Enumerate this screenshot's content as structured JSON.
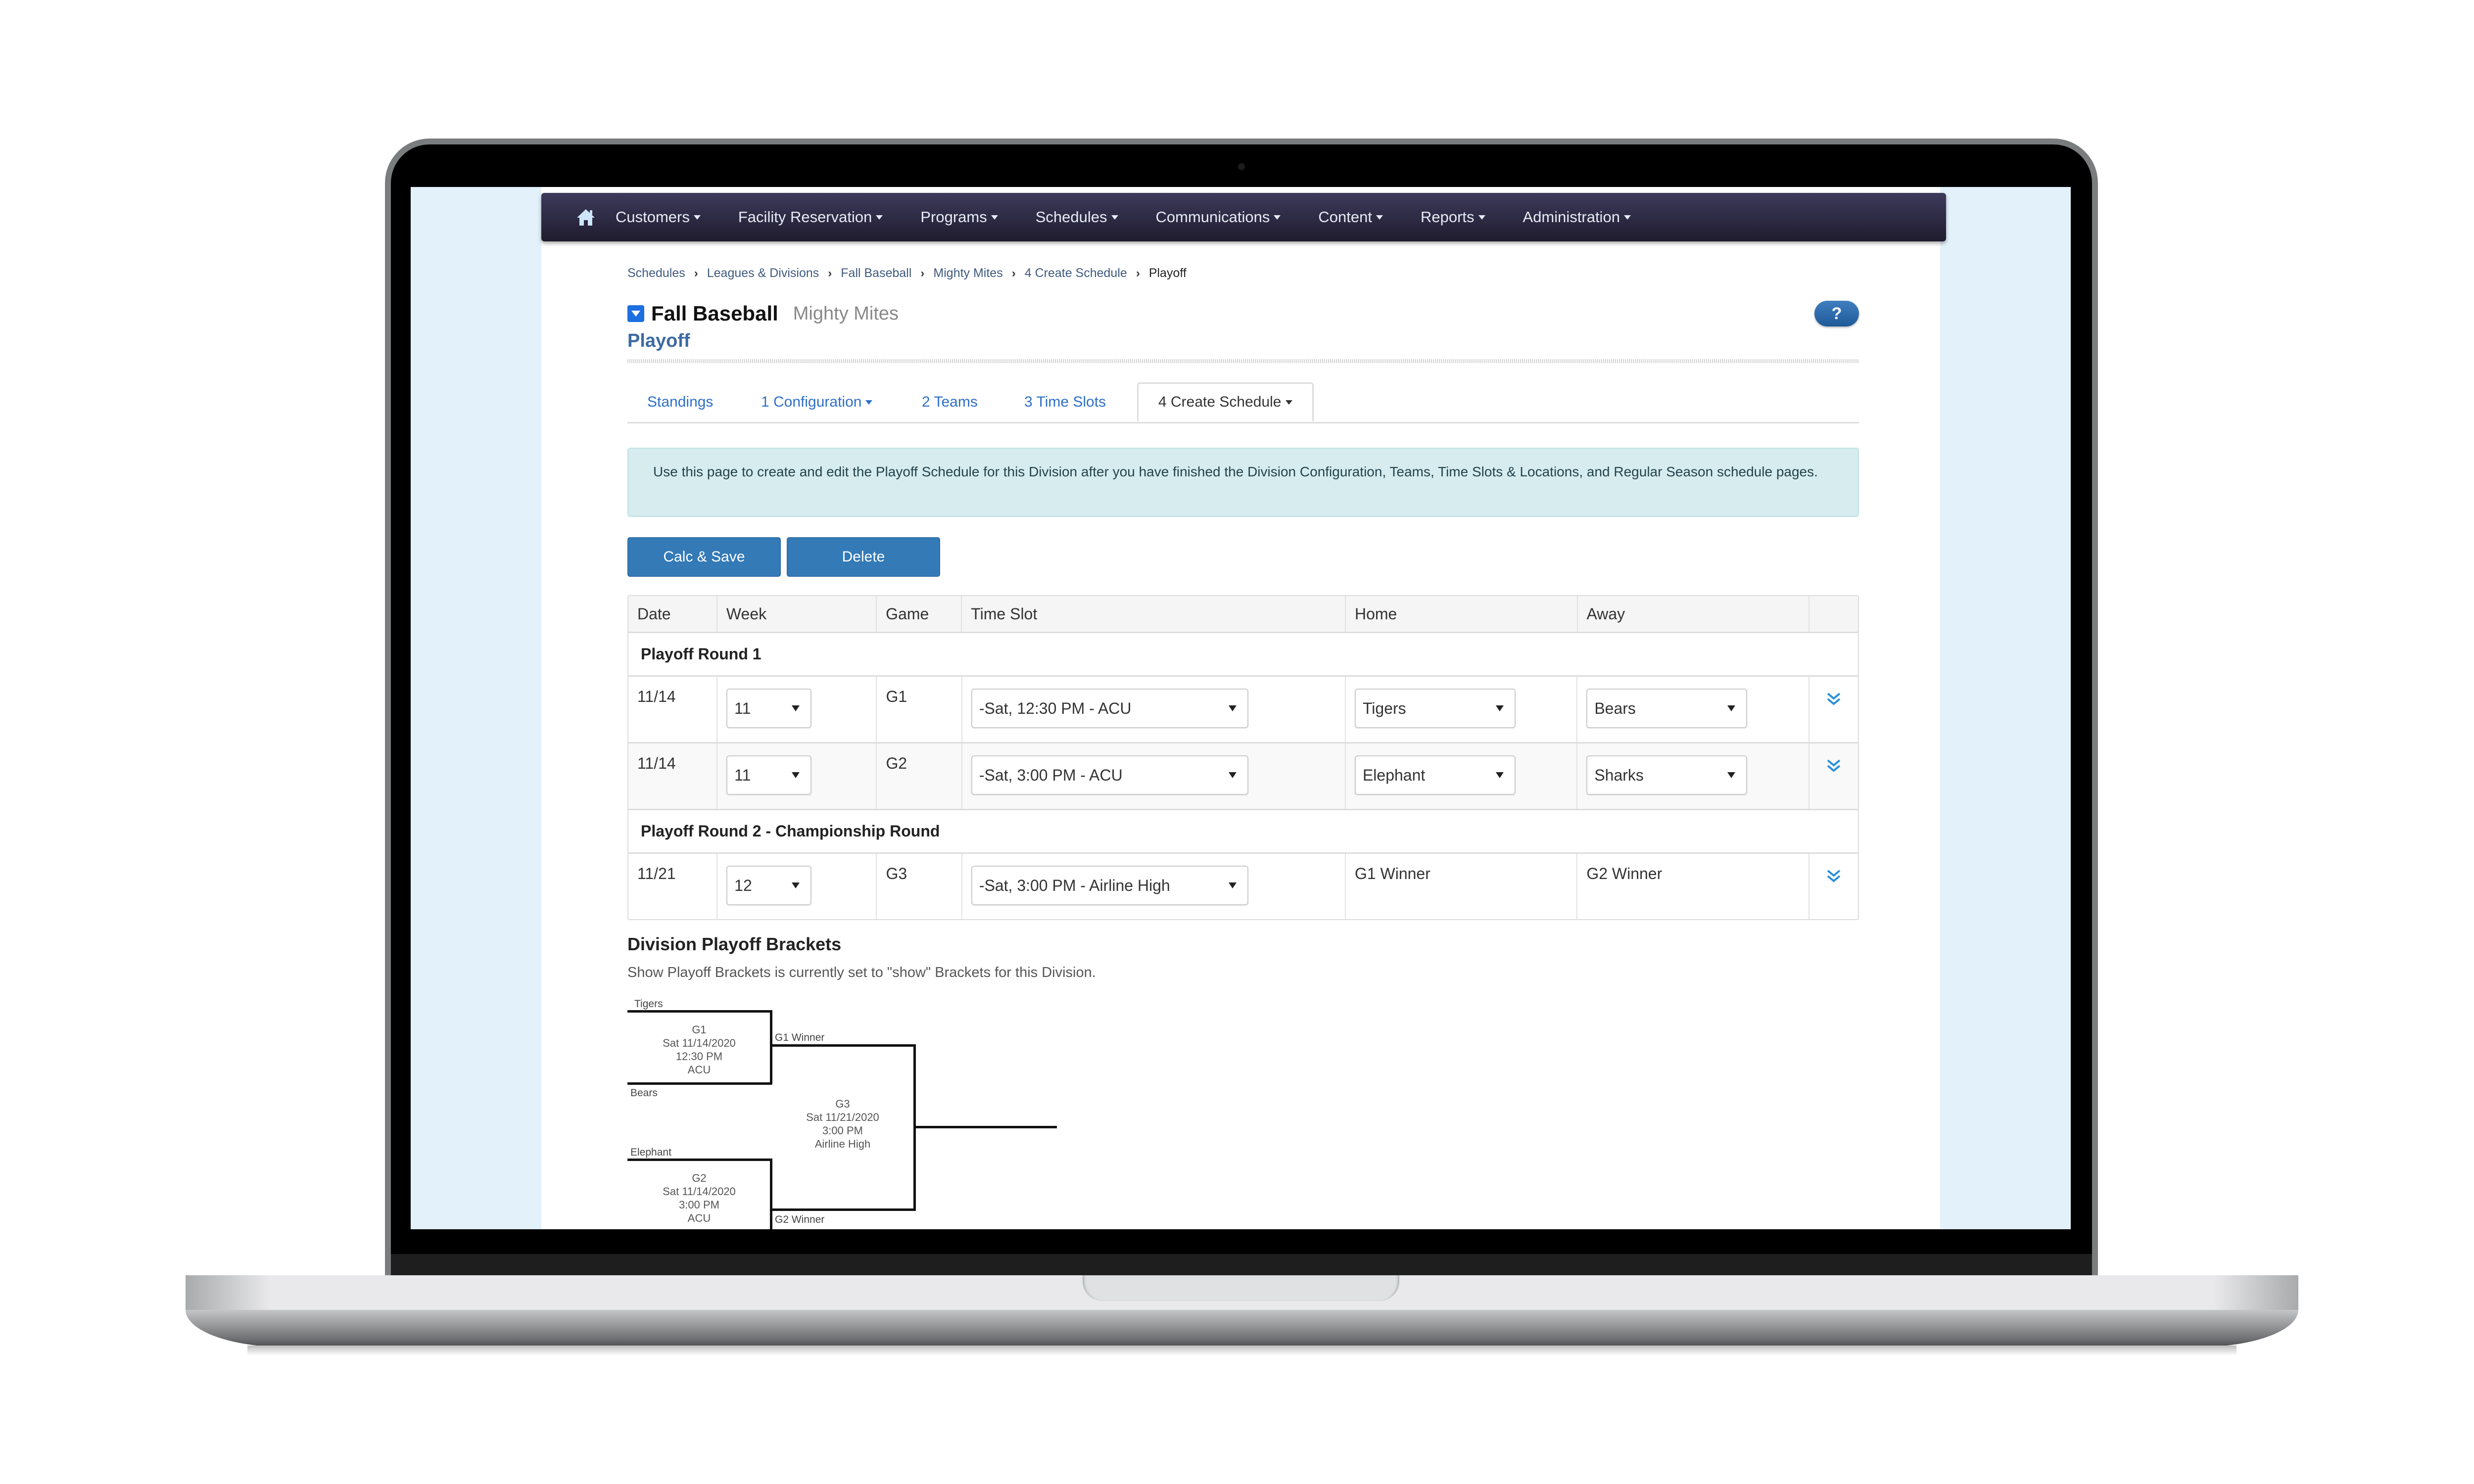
{
  "nav": {
    "home_icon": "home-icon",
    "items": [
      {
        "label": "Customers"
      },
      {
        "label": "Facility Reservation"
      },
      {
        "label": "Programs"
      },
      {
        "label": "Schedules"
      },
      {
        "label": "Communications"
      },
      {
        "label": "Content"
      },
      {
        "label": "Reports"
      },
      {
        "label": "Administration"
      }
    ]
  },
  "breadcrumb": [
    "Schedules",
    "Leagues & Divisions",
    "Fall Baseball",
    "Mighty Mites",
    "4 Create Schedule",
    "Playoff"
  ],
  "header": {
    "title": "Fall Baseball",
    "division": "Mighty Mites",
    "subtitle": "Playoff",
    "help_label": "?"
  },
  "tabs": [
    {
      "label": "Standings",
      "dropdown": false
    },
    {
      "label": "1 Configuration",
      "dropdown": true
    },
    {
      "label": "2 Teams",
      "dropdown": false
    },
    {
      "label": "3 Time Slots",
      "dropdown": false
    },
    {
      "label": "4 Create Schedule",
      "dropdown": true,
      "active": true
    }
  ],
  "info_text": "Use this page to create and edit the Playoff Schedule for this Division after you have finished the Division Configuration, Teams, Time Slots & Locations, and Regular Season schedule pages.",
  "actions": {
    "calc_save": "Calc & Save",
    "delete": "Delete"
  },
  "table": {
    "columns": [
      "Date",
      "Week",
      "Game",
      "Time Slot",
      "Home",
      "Away",
      ""
    ],
    "groups": [
      {
        "title": "Playoff Round 1",
        "rows": [
          {
            "date": "11/14",
            "week": "11",
            "game": "G1",
            "time_slot": "-Sat, 12:30 PM - ACU",
            "home": "Tigers",
            "away": "Bears",
            "home_select": true
          },
          {
            "date": "11/14",
            "week": "11",
            "game": "G2",
            "time_slot": "-Sat, 3:00 PM - ACU",
            "home": "Elephant",
            "away": "Sharks",
            "home_select": true
          }
        ]
      },
      {
        "title": "Playoff Round 2 - Championship Round",
        "rows": [
          {
            "date": "11/21",
            "week": "12",
            "game": "G3",
            "time_slot": "-Sat, 3:00 PM - Airline High",
            "home": "G1 Winner",
            "away": "G2 Winner",
            "home_select": false
          }
        ]
      }
    ]
  },
  "brackets": {
    "title": "Division Playoff Brackets",
    "description": "Show Playoff Brackets is currently set to \"show\" Brackets for this Division.",
    "games": [
      {
        "top": "Tigers",
        "bottom": "Bears",
        "lines": [
          "G1",
          "Sat 11/14/2020",
          "12:30 PM",
          "ACU"
        ]
      },
      {
        "top": "Elephant",
        "bottom": "",
        "lines": [
          "G2",
          "Sat 11/14/2020",
          "3:00 PM",
          "ACU"
        ]
      },
      {
        "top": "G1 Winner",
        "bottom": "G2 Winner",
        "lines": [
          "G3",
          "Sat 11/21/2020",
          "3:00 PM",
          "Airline High"
        ]
      }
    ]
  },
  "colors": {
    "nav_bg": "#2b283f",
    "primary": "#337ab7",
    "link": "#2e6fc6",
    "info_bg": "#d6ecef"
  }
}
